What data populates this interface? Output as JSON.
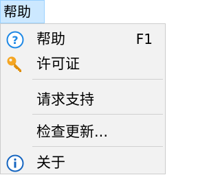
{
  "menubar": {
    "help_menu_label": "帮助"
  },
  "menu": {
    "items": [
      {
        "label": "帮助",
        "shortcut": "F1",
        "icon": "help-question-icon"
      },
      {
        "label": "许可证",
        "icon": "key-icon"
      },
      {
        "label": "请求支持"
      },
      {
        "label": "检查更新..."
      },
      {
        "label": "关于",
        "icon": "info-icon"
      }
    ]
  },
  "colors": {
    "menubar_active_bg": "#cce8ff",
    "menubar_active_border": "#99d1ff",
    "menu_bg": "#f2f2f2",
    "help_icon_blue": "#1e88e5",
    "key_icon_orange": "#f5a623",
    "info_icon_blue": "#1565c0"
  }
}
